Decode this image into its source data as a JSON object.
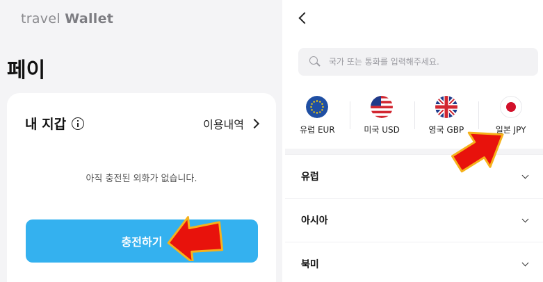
{
  "left": {
    "brand_light": "travel ",
    "brand_bold": "Wallet",
    "page_title": "페이",
    "wallet": {
      "title": "내 지갑",
      "history_label": "이용내역",
      "empty_message": "아직 충전된 외화가 없습니다.",
      "charge_button": "충전하기"
    }
  },
  "right": {
    "search": {
      "placeholder": "국가 또는 통화를 입력해주세요."
    },
    "currencies": [
      {
        "label": "유럽 EUR",
        "icon": "eu-flag-icon"
      },
      {
        "label": "미국 USD",
        "icon": "us-flag-icon"
      },
      {
        "label": "영국 GBP",
        "icon": "uk-flag-icon"
      },
      {
        "label": "일본 JPY",
        "icon": "japan-flag-icon"
      }
    ],
    "regions": [
      {
        "label": "유럽"
      },
      {
        "label": "아시아"
      },
      {
        "label": "북미"
      }
    ]
  },
  "colors": {
    "accent": "#34b1ef",
    "annotation_arrow_fill": "#e8120c",
    "annotation_arrow_outline": "#f6b21b"
  }
}
